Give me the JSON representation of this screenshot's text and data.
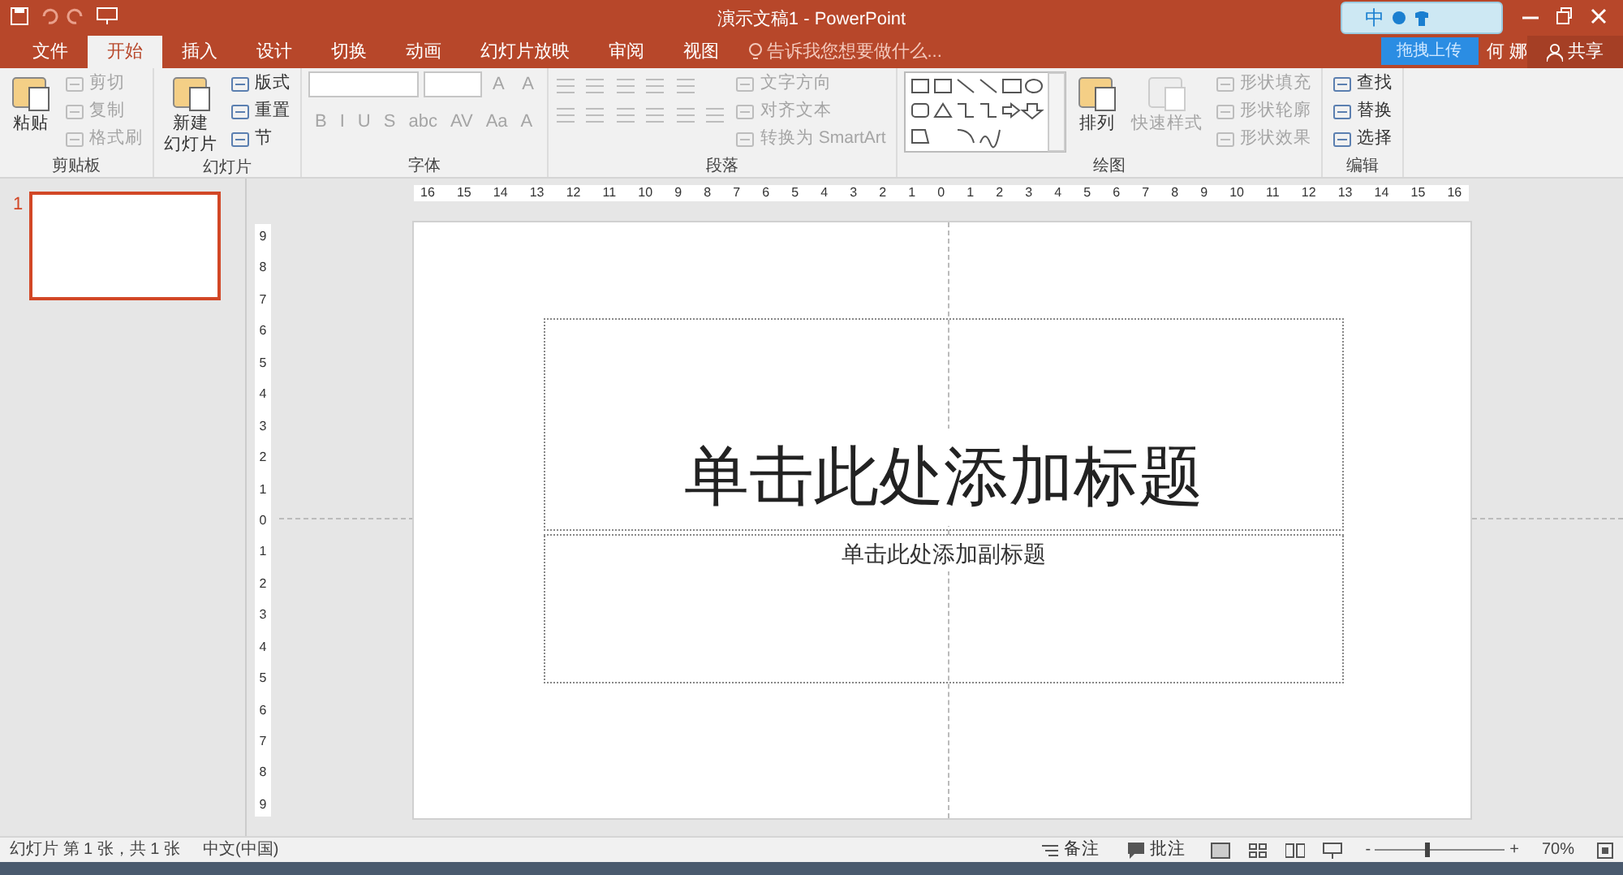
{
  "window": {
    "title": "演示文稿1 - PowerPoint",
    "user": "何 娜",
    "share": "共享"
  },
  "ime": {
    "mode": "中",
    "upload": "拖拽上传"
  },
  "tabs": [
    {
      "label": "文件",
      "selected": false
    },
    {
      "label": "开始",
      "selected": true
    },
    {
      "label": "插入",
      "selected": false
    },
    {
      "label": "设计",
      "selected": false
    },
    {
      "label": "切换",
      "selected": false
    },
    {
      "label": "动画",
      "selected": false
    },
    {
      "label": "幻灯片放映",
      "selected": false
    },
    {
      "label": "审阅",
      "selected": false
    },
    {
      "label": "视图",
      "selected": false
    }
  ],
  "tell_me": {
    "placeholder": "告诉我您想要做什么..."
  },
  "ribbon": {
    "groups": [
      {
        "label": "剪贴板",
        "items": [
          {
            "kind": "large",
            "lines": [
              "粘贴"
            ],
            "disabled": false
          },
          {
            "kind": "small",
            "text": "剪切",
            "disabled": true
          },
          {
            "kind": "small",
            "text": "复制",
            "disabled": true
          },
          {
            "kind": "small",
            "text": "格式刷",
            "disabled": true
          }
        ]
      },
      {
        "label": "幻灯片",
        "items": [
          {
            "kind": "large",
            "lines": [
              "新建",
              "幻灯片"
            ],
            "disabled": false
          },
          {
            "kind": "small",
            "text": "版式",
            "disabled": false
          },
          {
            "kind": "small",
            "text": "重置",
            "disabled": false
          },
          {
            "kind": "small",
            "text": "节",
            "disabled": false
          }
        ]
      },
      {
        "label": "字体",
        "items": [
          {
            "kind": "fontrow",
            "glyphs": [
              "A",
              "A"
            ],
            "disabled": true
          },
          {
            "kind": "glyphrow",
            "glyphs": [
              "B",
              "I",
              "U",
              "S",
              "abc",
              "AV",
              "Aa",
              "A"
            ],
            "disabled": true
          }
        ]
      },
      {
        "label": "段落",
        "items": [
          {
            "kind": "listrow",
            "disabled": true
          },
          {
            "kind": "alignrow",
            "disabled": true
          },
          {
            "kind": "small",
            "text": "文字方向",
            "disabled": true
          },
          {
            "kind": "small",
            "text": "对齐文本",
            "disabled": true
          },
          {
            "kind": "small",
            "text": "转换为 SmartArt",
            "disabled": true
          }
        ]
      },
      {
        "label": "绘图",
        "items": [
          {
            "kind": "gallery",
            "disabled": false
          },
          {
            "kind": "large",
            "lines": [
              "排列"
            ],
            "disabled": false
          },
          {
            "kind": "large",
            "lines": [
              "快速样式"
            ],
            "disabled": true
          },
          {
            "kind": "small",
            "text": "形状填充",
            "disabled": true
          },
          {
            "kind": "small",
            "text": "形状轮廓",
            "disabled": true
          },
          {
            "kind": "small",
            "text": "形状效果",
            "disabled": true
          }
        ]
      },
      {
        "label": "编辑",
        "items": [
          {
            "kind": "small",
            "text": "查找",
            "disabled": false
          },
          {
            "kind": "small",
            "text": "替换",
            "disabled": false
          },
          {
            "kind": "small",
            "text": "选择",
            "disabled": false
          }
        ]
      }
    ]
  },
  "thumbnails": [
    {
      "number": "1",
      "selected": true
    }
  ],
  "ruler_h": [
    "16",
    "15",
    "14",
    "13",
    "12",
    "11",
    "10",
    "9",
    "8",
    "7",
    "6",
    "5",
    "4",
    "3",
    "2",
    "1",
    "0",
    "1",
    "2",
    "3",
    "4",
    "5",
    "6",
    "7",
    "8",
    "9",
    "10",
    "11",
    "12",
    "13",
    "14",
    "15",
    "16"
  ],
  "ruler_v": [
    "9",
    "8",
    "7",
    "6",
    "5",
    "4",
    "3",
    "2",
    "1",
    "0",
    "1",
    "2",
    "3",
    "4",
    "5",
    "6",
    "7",
    "8",
    "9"
  ],
  "slide": {
    "title_placeholder": "单击此处添加标题",
    "subtitle_placeholder": "单击此处添加副标题"
  },
  "status_bar": {
    "slide_info": "幻灯片 第 1 张，共 1 张",
    "language": "中文(中国)",
    "notes": "备注",
    "comments": "批注",
    "zoom_out": "-",
    "zoom_in": "+",
    "zoom": "70%",
    "level": 0.4
  }
}
